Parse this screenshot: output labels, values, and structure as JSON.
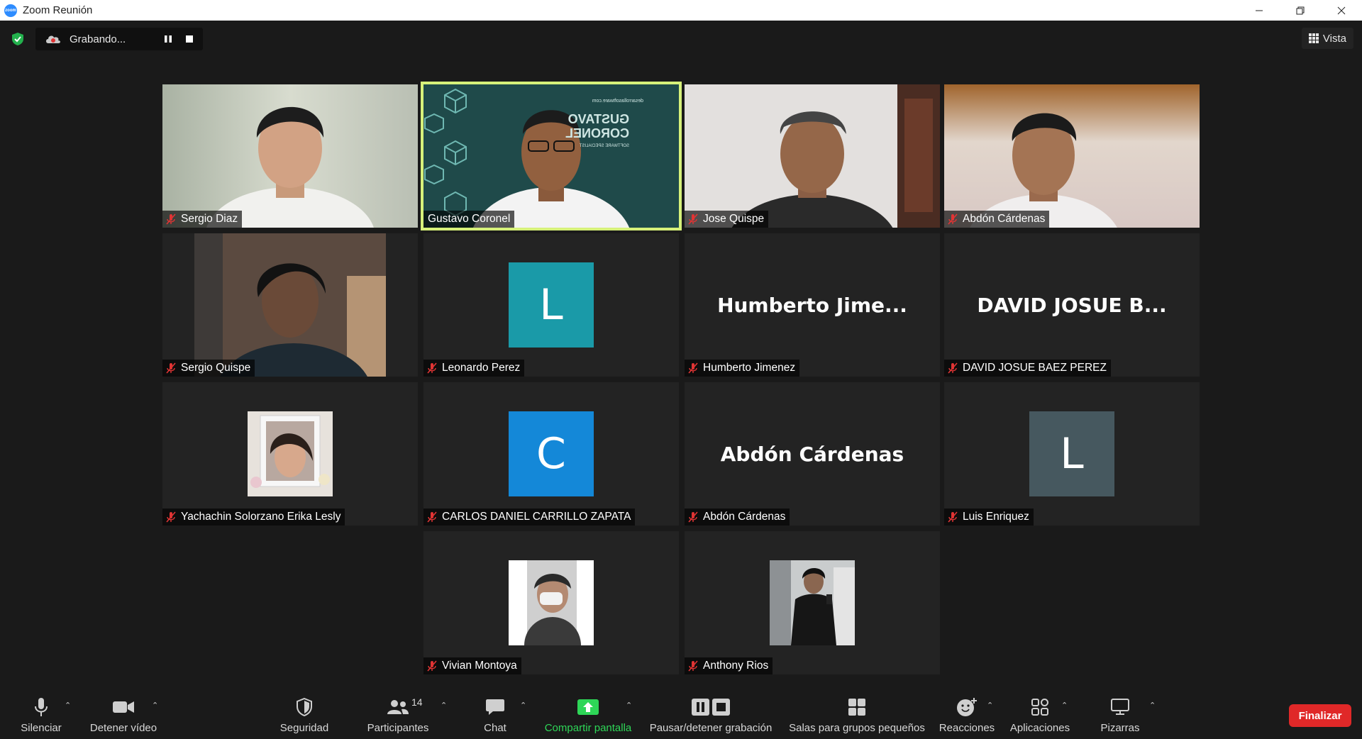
{
  "window": {
    "title": "Zoom Reunión",
    "logo_text": "zoom"
  },
  "top": {
    "recording_label": "Grabando...",
    "view_label": "Vista"
  },
  "tiles": [
    {
      "name": "Sergio Diaz"
    },
    {
      "name": "Gustavo Coronel",
      "banner_line1": "GUSTAVO",
      "banner_line2": "CORONEL",
      "banner_sub": "SOFTWARE SPECIALIST",
      "banner_url": "desarrollasoftware.com"
    },
    {
      "name": "Jose Quispe"
    },
    {
      "name": "Abdón Cárdenas"
    },
    {
      "name": "Sergio Quispe"
    },
    {
      "name": "Leonardo Perez",
      "initial": "L"
    },
    {
      "name": "Humberto Jimenez",
      "display": "Humberto  Jime..."
    },
    {
      "name": "DAVID JOSUE BAEZ PEREZ",
      "display": "DAVID JOSUE B..."
    },
    {
      "name": "Yachachin Solorzano Erika Lesly"
    },
    {
      "name": "CARLOS DANIEL CARRILLO ZAPATA",
      "initial": "C"
    },
    {
      "name": "Abdón Cárdenas",
      "display": "Abdón Cárdenas"
    },
    {
      "name": "Luis Enriquez",
      "initial": "L"
    },
    {
      "name": "Vivian Montoya"
    },
    {
      "name": "Anthony Rios"
    }
  ],
  "colors": {
    "active_border": "#d6f17a",
    "teal_avatar": "#1a9aa8",
    "blue_avatar": "#1488d8",
    "slate_avatar": "#46585f",
    "end_red": "#e02828",
    "share_green": "#2ed657"
  },
  "toolbar": {
    "mute": "Silenciar",
    "video": "Detener vídeo",
    "security": "Seguridad",
    "participants": "Participantes",
    "participants_count": "14",
    "chat": "Chat",
    "share": "Compartir pantalla",
    "record": "Pausar/detener grabación",
    "breakout": "Salas para grupos pequeños",
    "reactions": "Reacciones",
    "apps": "Aplicaciones",
    "whiteboards": "Pizarras",
    "end": "Finalizar"
  }
}
